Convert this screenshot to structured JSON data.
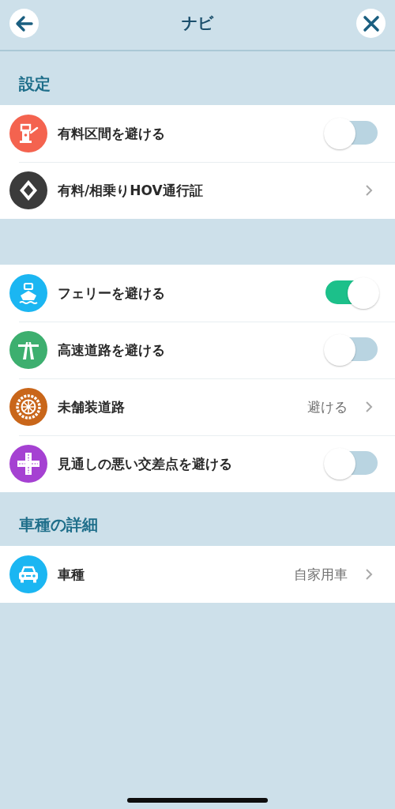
{
  "header": {
    "title": "ナビ"
  },
  "sections": [
    {
      "title": "設定",
      "rows": [
        {
          "kind": "toggle",
          "color": "#f4634f",
          "label": "有料区間を避ける",
          "on": false
        },
        {
          "kind": "link",
          "color": "#3b3b3b",
          "label": "有料/相乗りHOV通行証"
        }
      ]
    },
    {
      "rows": [
        {
          "kind": "toggle",
          "color": "#1bb6f2",
          "label": "フェリーを避ける",
          "on": true
        },
        {
          "kind": "toggle",
          "color": "#3daf6f",
          "label": "高速道路を避ける",
          "on": false
        },
        {
          "kind": "link",
          "color": "#c9661a",
          "label": "未舗装道路",
          "value": "避ける"
        },
        {
          "kind": "toggle",
          "color": "#a541d2",
          "label": "見通しの悪い交差点を避ける",
          "on": false
        }
      ]
    },
    {
      "title": "車種の詳細",
      "rows": [
        {
          "kind": "link",
          "color": "#1bb6f2",
          "label": "車種",
          "value": "自家用車"
        }
      ]
    }
  ]
}
